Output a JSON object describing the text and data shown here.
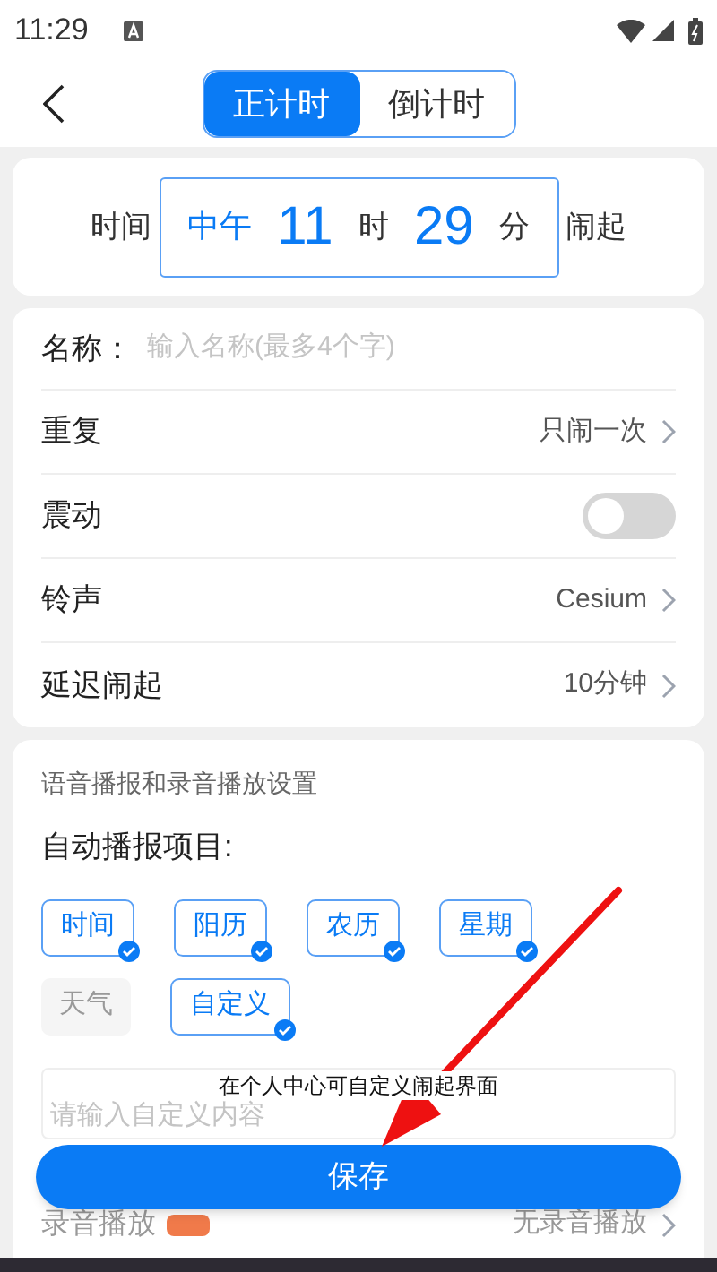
{
  "status_bar": {
    "time": "11:29"
  },
  "header": {
    "tabs": [
      {
        "label": "正计时",
        "selected": true
      },
      {
        "label": "倒计时",
        "selected": false
      }
    ]
  },
  "time_card": {
    "prefix": "时间",
    "period": "中午",
    "hour": "11",
    "hour_unit": "时",
    "minute": "29",
    "minute_unit": "分",
    "suffix": "闹起"
  },
  "name_field": {
    "label": "名称：",
    "placeholder": "输入名称(最多4个字)"
  },
  "settings": [
    {
      "kind": "link",
      "label": "重复",
      "value": "只闹一次"
    },
    {
      "kind": "toggle",
      "label": "震动",
      "on": false
    },
    {
      "kind": "link",
      "label": "铃声",
      "value": "Cesium"
    },
    {
      "kind": "link",
      "label": "延迟闹起",
      "value": "10分钟"
    }
  ],
  "voice": {
    "title": "语音播报和录音播放设置",
    "subtitle": "自动播报项目:",
    "items": [
      {
        "label": "时间",
        "checked": true
      },
      {
        "label": "阳历",
        "checked": true
      },
      {
        "label": "农历",
        "checked": true
      },
      {
        "label": "星期",
        "checked": true
      },
      {
        "label": "天气",
        "checked": false
      },
      {
        "label": "自定义",
        "checked": true
      }
    ],
    "toast": "在个人中心可自定义闹起界面",
    "custom_placeholder": "请输入自定义内容",
    "recording": {
      "label": "录音播放",
      "value": "无录音播放"
    }
  },
  "save_button": "保存"
}
